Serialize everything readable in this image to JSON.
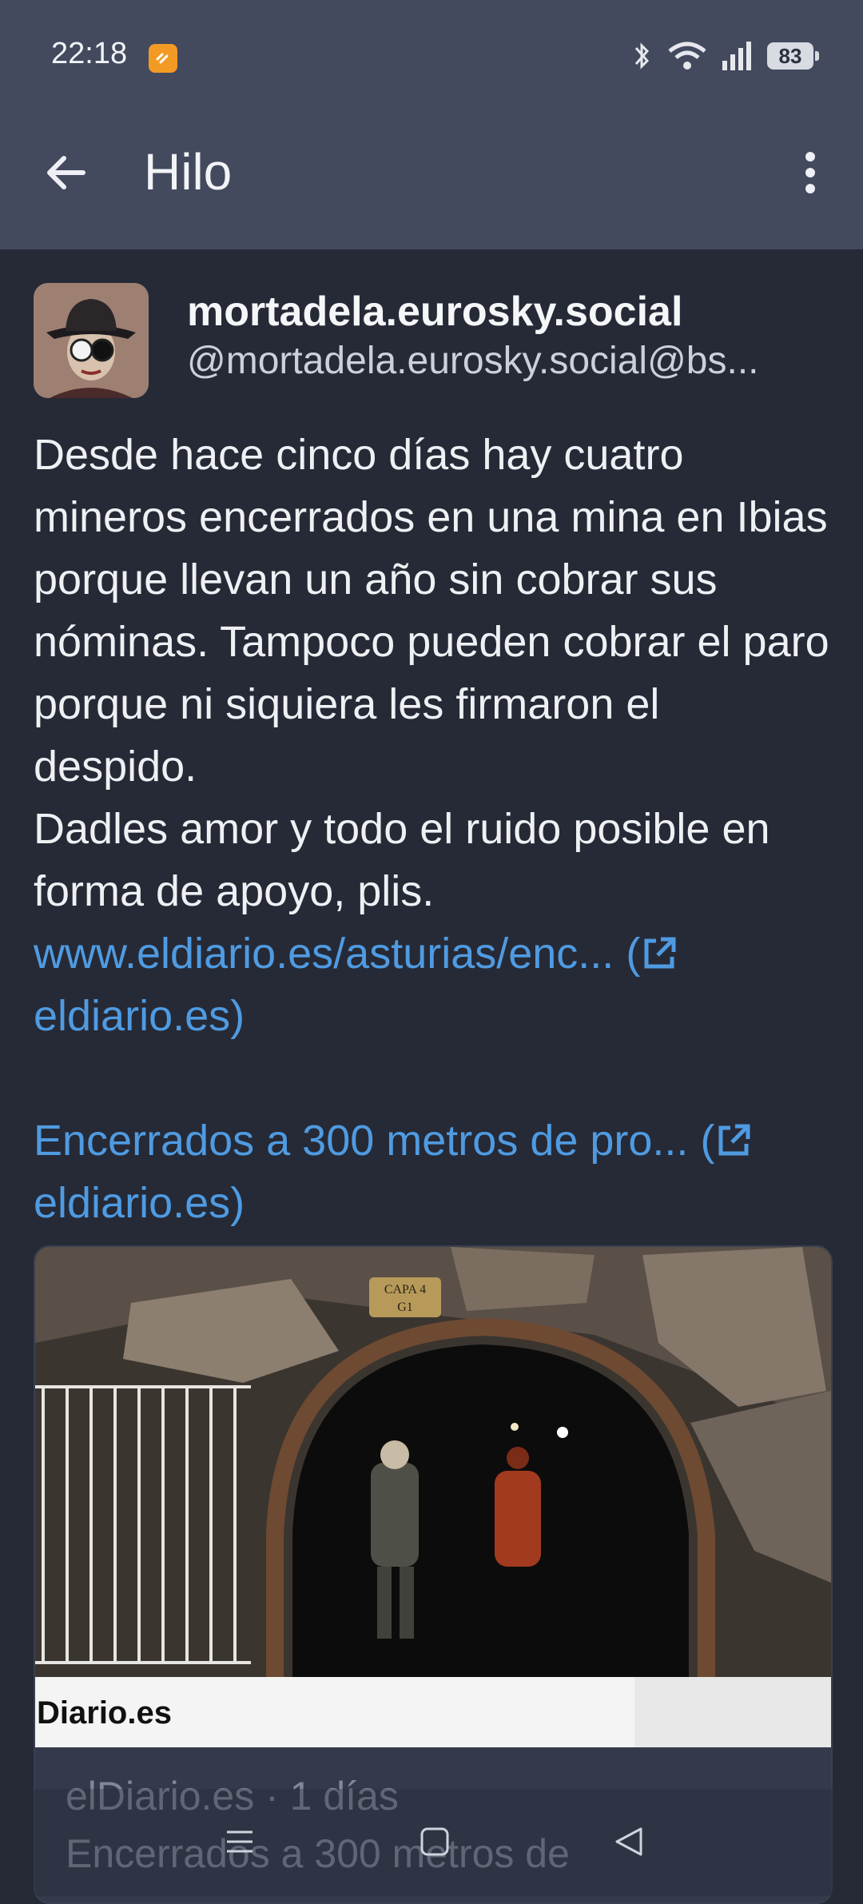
{
  "status_bar": {
    "time": "22:18",
    "battery": "83"
  },
  "app_bar": {
    "title": "Hilo"
  },
  "post": {
    "display_name": "mortadela.eurosky.social",
    "handle": "@mortadela.eurosky.social@bs...",
    "paragraph_1": "Desde hace cinco días hay cuatro mineros encerrados en una mina en Ibias porque llevan un año sin cobrar sus nóminas. Tampoco pueden cobrar el paro porque ni siquiera les firmaron el despido.",
    "paragraph_2": "Dadles amor y todo el ruido posible en forma de apoyo, plis.",
    "link_1": "www.eldiario.es/asturias/enc... (",
    "link_1_domain": "eldiario.es)",
    "link_2": "Encerrados a 300 metros de pro... (",
    "link_2_domain": "eldiario.es)"
  },
  "card": {
    "image_text_sign": "CAPA 4 G1",
    "image_brand": "Diario.es",
    "meta": "elDiario.es · 1 días",
    "title": "Encerrados a 300 metros de"
  },
  "colors": {
    "accent": "#4f9be2",
    "appbar": "#434a5e",
    "background": "#262a36"
  }
}
